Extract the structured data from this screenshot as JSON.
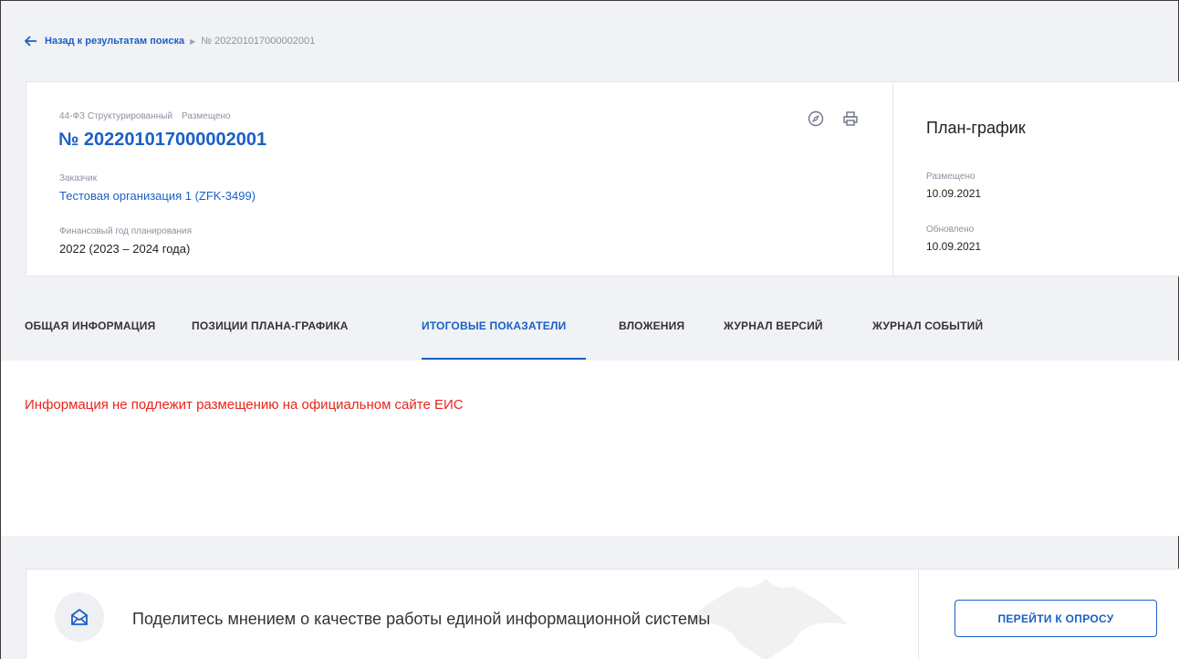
{
  "breadcrumb": {
    "back_label": "Назад к результатам поиска",
    "current": "№ 202201017000002001"
  },
  "card": {
    "law": "44-ФЗ Структурированный",
    "status": "Размещено",
    "number": "№ 202201017000002001",
    "customer_label": "Заказчик",
    "customer_value": "Тестовая организация 1 (ZFK-3499)",
    "fin_year_label": "Финансовый год планирования",
    "fin_year_value": "2022 (2023 – 2024 года)",
    "icons": [
      "compass-icon",
      "print-icon"
    ]
  },
  "side": {
    "title": "План-график",
    "placed_label": "Размещено",
    "placed_value": "10.09.2021",
    "updated_label": "Обновлено",
    "updated_value": "10.09.2021"
  },
  "tabs": [
    {
      "label": "ОБЩАЯ ИНФОРМАЦИЯ",
      "active": false
    },
    {
      "label": "ПОЗИЦИИ ПЛАНА-ГРАФИКА",
      "active": false
    },
    {
      "label": "ИТОГОВЫЕ ПОКАЗАТЕЛИ",
      "active": true
    },
    {
      "label": "ВЛОЖЕНИЯ",
      "active": false
    },
    {
      "label": "ЖУРНАЛ ВЕРСИЙ",
      "active": false
    },
    {
      "label": "ЖУРНАЛ СОБЫТИЙ",
      "active": false
    }
  ],
  "notice": "Информация не подлежит размещению на официальном сайте ЕИС",
  "feedback": {
    "text": "Поделитесь мнением о качестве работы единой информационной системы",
    "button": "ПЕРЕЙТИ К ОПРОСУ"
  },
  "colors": {
    "accent": "#1a5fc7",
    "warning": "#e8251c",
    "background": "#f0f2f5"
  }
}
